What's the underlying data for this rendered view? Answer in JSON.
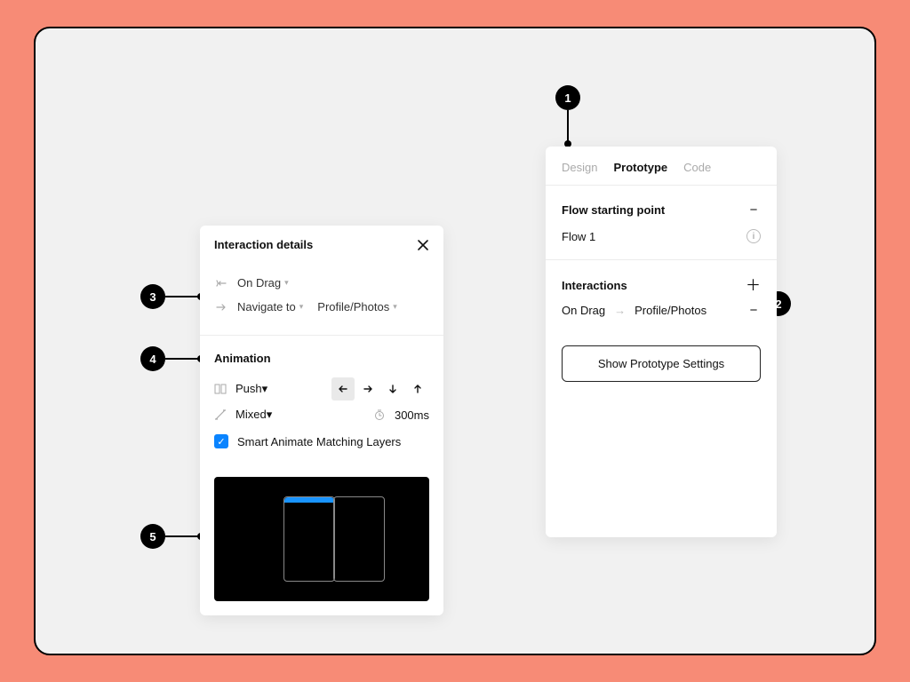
{
  "annotations": {
    "b1": "1",
    "b2": "2",
    "b3": "3",
    "b4": "4",
    "b5": "5"
  },
  "interaction_details": {
    "title": "Interaction details",
    "trigger": {
      "label": "On Drag"
    },
    "action": {
      "label": "Navigate to",
      "target": "Profile/Photos"
    },
    "animation": {
      "section_title": "Animation",
      "type": "Push",
      "easing": "Mixed",
      "duration": "300ms",
      "direction_selected": "left",
      "smart_animate_label": "Smart Animate Matching Layers",
      "smart_animate_checked": true
    }
  },
  "sidebar": {
    "tabs": {
      "design": "Design",
      "prototype": "Prototype",
      "code": "Code",
      "active": "prototype"
    },
    "flow": {
      "section_title": "Flow starting point",
      "name": "Flow 1"
    },
    "interactions": {
      "section_title": "Interactions",
      "items": [
        {
          "trigger": "On Drag",
          "target": "Profile/Photos"
        }
      ]
    },
    "show_settings_label": "Show Prototype Settings"
  }
}
